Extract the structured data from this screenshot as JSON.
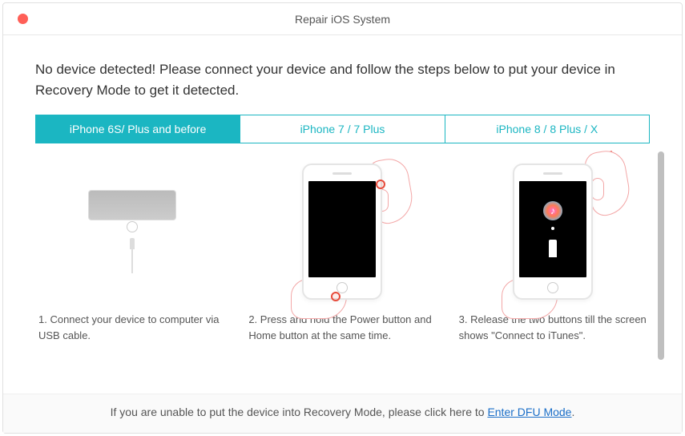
{
  "window": {
    "title": "Repair iOS System"
  },
  "heading": "No device detected! Please connect your device and follow the steps below to put your device in Recovery Mode to get it detected.",
  "tabs": {
    "items": [
      {
        "label": "iPhone 6S/ Plus and before",
        "active": true
      },
      {
        "label": "iPhone 7 / 7 Plus",
        "active": false
      },
      {
        "label": "iPhone 8 / 8 Plus / X",
        "active": false
      }
    ]
  },
  "steps": {
    "items": [
      {
        "text": "1. Connect your device to computer via USB cable."
      },
      {
        "text": "2. Press and hold the Power button and Home button at the same time."
      },
      {
        "text": "3. Release the two buttons till the screen shows \"Connect to iTunes\"."
      }
    ]
  },
  "footer": {
    "prefix": "If you are unable to put the device into Recovery Mode, please click here to ",
    "link": "Enter DFU Mode",
    "suffix": "."
  }
}
